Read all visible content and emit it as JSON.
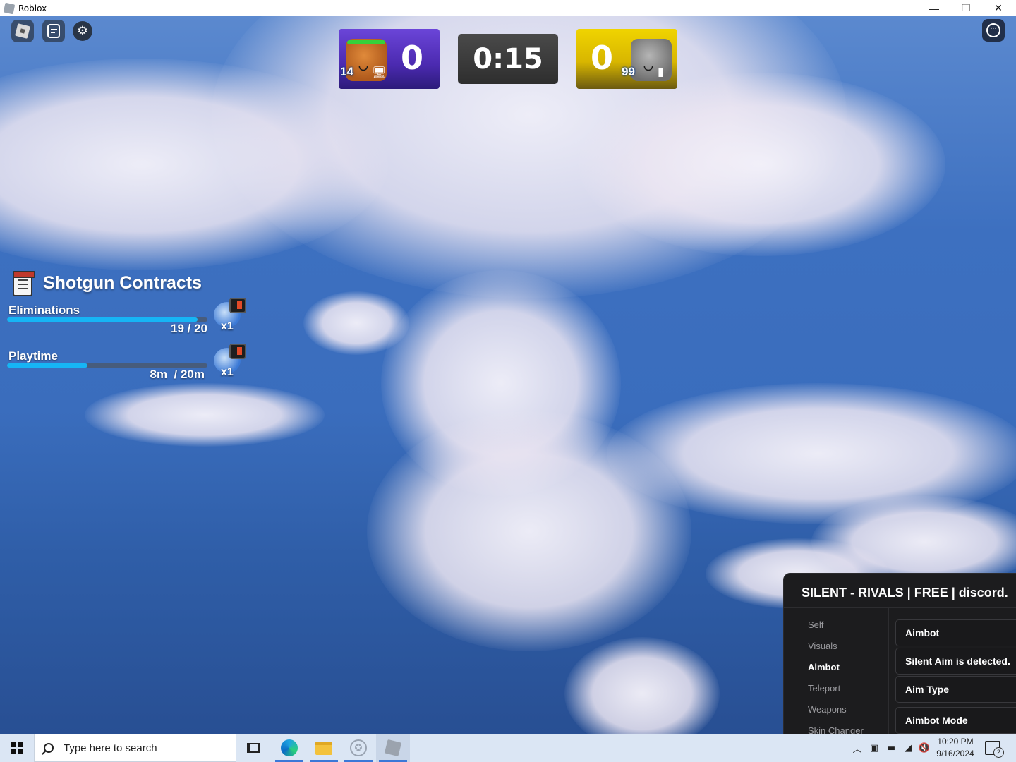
{
  "window": {
    "title": "Roblox",
    "controls": {
      "minimize": "—",
      "restore": "❐",
      "close": "✕"
    }
  },
  "hud": {
    "icons": [
      "roblox-menu-icon",
      "chat-icon",
      "settings-icon",
      "more-options-icon"
    ],
    "scoreboard": {
      "left_score": "0",
      "left_level": "14",
      "left_device": "desktop-icon",
      "timer": "0:15",
      "right_score": "0",
      "right_level": "99",
      "right_device": "mobile-icon",
      "left_color": "#5a36c8",
      "right_color": "#e3c200"
    }
  },
  "contracts": {
    "title": "Shotgun Contracts",
    "items": [
      {
        "label": "Eliminations",
        "progress_text": "19 / 20",
        "progress": 0.95,
        "reward_mult": "x1"
      },
      {
        "label": "Playtime",
        "progress_text": "8m  / 20m",
        "progress": 0.4,
        "reward_mult": "x1"
      }
    ],
    "accent": "#16b5f5"
  },
  "menu": {
    "title": "SILENT - RIVALS | FREE | discord.",
    "tabs": [
      "Self",
      "Visuals",
      "Aimbot",
      "Teleport",
      "Weapons",
      "Skin Changer"
    ],
    "active_tab": "Aimbot",
    "rows": [
      "Aimbot",
      "Silent Aim is detected.",
      "Aim Type",
      "Aimbot Mode"
    ]
  },
  "taskbar": {
    "search_placeholder": "Type here to search",
    "apps": [
      "task-view-icon",
      "edge-icon",
      "file-explorer-icon",
      "app-icon",
      "roblox-icon"
    ],
    "clock_time": "10:20 PM",
    "clock_date": "9/16/2024",
    "notification_count": "2"
  }
}
